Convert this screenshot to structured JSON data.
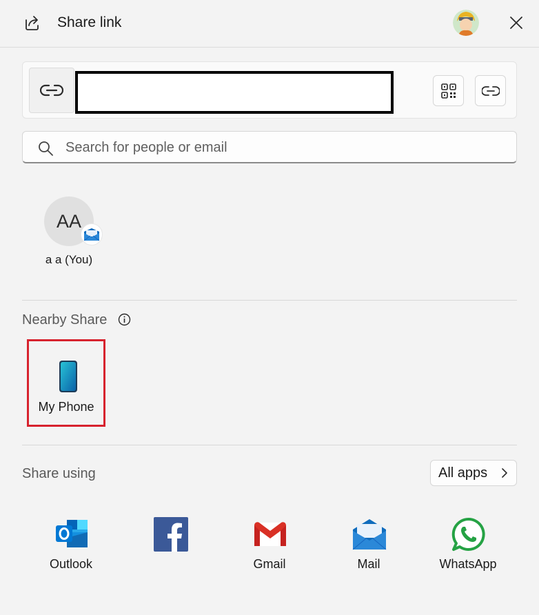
{
  "header": {
    "title": "Share link",
    "share_icon": "share-icon",
    "avatar_icon": "user-avatar",
    "close_icon": "close-icon"
  },
  "link": {
    "link_icon": "link-icon",
    "url": "",
    "qr_icon": "qr-code-icon",
    "copy_icon": "copy-link-icon"
  },
  "search": {
    "placeholder": "Search for people or email",
    "value": ""
  },
  "contacts": [
    {
      "initials": "AA",
      "name": "a a (You)",
      "badge_icon": "mail-icon"
    }
  ],
  "nearby": {
    "label": "Nearby Share",
    "info_icon": "info-icon",
    "devices": [
      {
        "name": "My Phone",
        "icon": "phone-icon"
      }
    ]
  },
  "share_using": {
    "label": "Share using",
    "all_apps_label": "All apps",
    "apps": [
      {
        "name": "Outlook",
        "icon": "outlook-icon"
      },
      {
        "name": "",
        "icon": "facebook-icon"
      },
      {
        "name": "Gmail",
        "icon": "gmail-icon"
      },
      {
        "name": "Mail",
        "icon": "mail-icon"
      },
      {
        "name": "WhatsApp",
        "icon": "whatsapp-icon"
      }
    ]
  },
  "colors": {
    "background": "#f3f3f3",
    "highlight_border": "#d7222e",
    "divider": "#d8d8d8"
  }
}
